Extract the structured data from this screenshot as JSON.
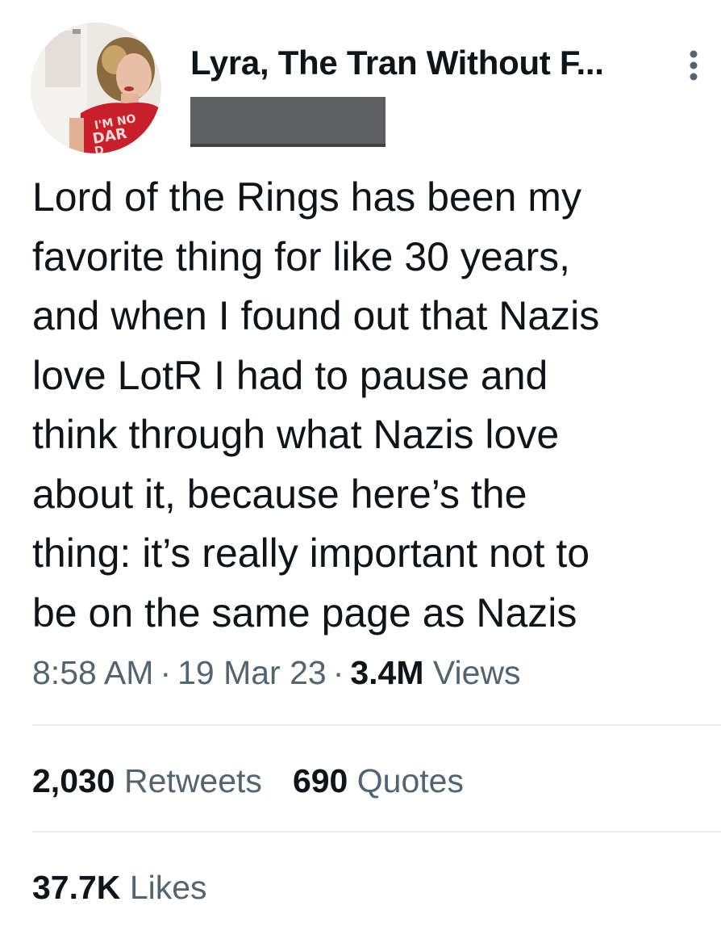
{
  "author": {
    "display_name": "Lyra, The Tran Without F...",
    "avatar_icon": "profile-photo",
    "shirt_text": [
      "I'M NO",
      "DAR",
      "D"
    ]
  },
  "tweet": {
    "text": "Lord of the Rings has been my\nfavorite thing for like 30 years,\nand when I found out that Nazis\nlove LotR I had to pause and\nthink through what Nazis love\nabout it, because here’s the\nthing: it’s really important not to\nbe on the same page as Nazis"
  },
  "meta": {
    "time": "8:58 AM",
    "separator": "·",
    "date": "19 Mar 23",
    "views_count": "3.4M",
    "views_label": "Views"
  },
  "stats": {
    "retweets_count": "2,030",
    "retweets_label": "Retweets",
    "quotes_count": "690",
    "quotes_label": "Quotes",
    "likes_count": "37.7K",
    "likes_label": "Likes"
  },
  "icons": {
    "more": "more-vertical-icon"
  },
  "colors": {
    "text_primary": "#0f1419",
    "text_secondary": "#536471",
    "divider": "#e6ecf0",
    "redaction": "#5e6063",
    "shirt_red": "#c8202b"
  }
}
